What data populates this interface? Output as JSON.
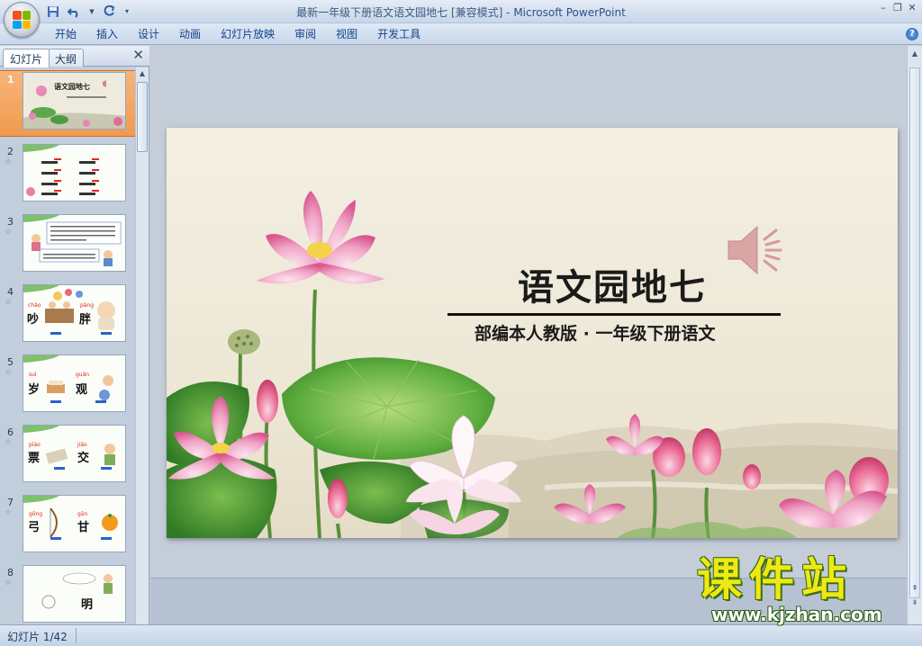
{
  "window": {
    "title": "最新一年级下册语文语文园地七 [兼容模式] - ",
    "app_name": "Microsoft PowerPoint"
  },
  "ribbon": {
    "tabs": [
      "开始",
      "插入",
      "设计",
      "动画",
      "幻灯片放映",
      "审阅",
      "视图",
      "开发工具"
    ]
  },
  "left_pane": {
    "tab_slides": "幻灯片",
    "tab_outline": "大纲",
    "thumbnails": [
      {
        "num": "1",
        "title": "语文园地七",
        "selected": true
      },
      {
        "num": "2",
        "title": "",
        "selected": false
      },
      {
        "num": "3",
        "title": "",
        "selected": false
      },
      {
        "num": "4",
        "title": "",
        "chars": [
          "吵",
          "胖"
        ],
        "pinyin": [
          "chǎo",
          "pàng"
        ],
        "selected": false
      },
      {
        "num": "5",
        "title": "",
        "chars": [
          "岁",
          "观"
        ],
        "pinyin": [
          "suì",
          "guān"
        ],
        "selected": false
      },
      {
        "num": "6",
        "title": "",
        "chars": [
          "票",
          "交"
        ],
        "pinyin": [
          "piào",
          "jiāo"
        ],
        "selected": false
      },
      {
        "num": "7",
        "title": "",
        "chars": [
          "弓",
          "甘"
        ],
        "pinyin": [
          "gōng",
          "gān"
        ],
        "selected": false
      },
      {
        "num": "8",
        "title": "",
        "chars": [
          "明"
        ],
        "pinyin": [],
        "selected": false
      }
    ]
  },
  "slide": {
    "title": "语文园地七",
    "subtitle": "部编本人教版 · 一年级下册语文"
  },
  "status": {
    "slide_indicator": "幻灯片 1/42"
  },
  "watermark": {
    "brand": "课件站",
    "url": "www.kjzhan.com"
  },
  "colors": {
    "accent_orange": "#f19a4f",
    "ribbon_text": "#15428b",
    "watermark_yellow": "#f0e814"
  }
}
